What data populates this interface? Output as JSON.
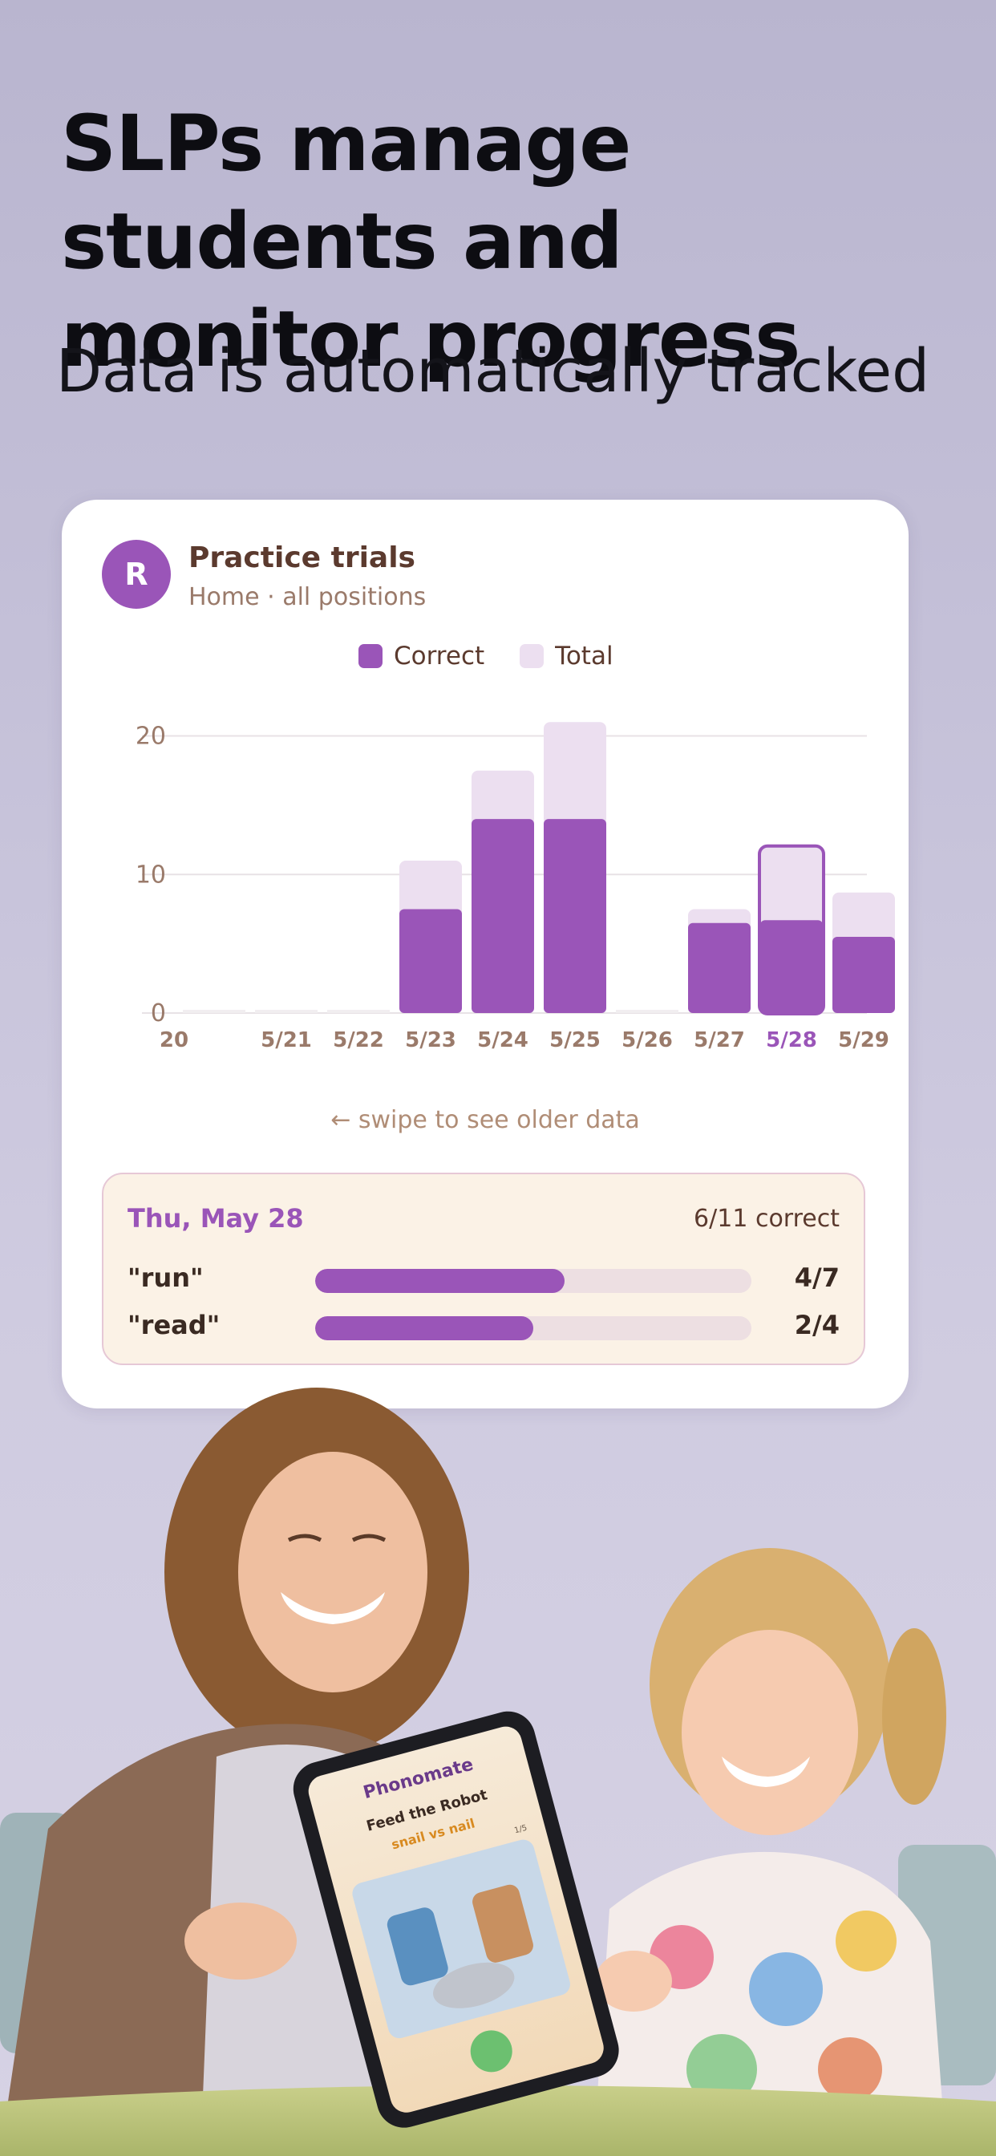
{
  "hero": {
    "title": "SLPs manage students and monitor progress",
    "subtitle": "Data is automatically tracked"
  },
  "card": {
    "avatar_letter": "R",
    "title": "Practice trials",
    "subtitle": "Home · all positions",
    "legend": [
      {
        "label": "Correct",
        "color": "#9a55b8"
      },
      {
        "label": "Total",
        "color": "#ecdff0"
      }
    ],
    "swipe_hint": "← swipe to see older data",
    "detail": {
      "date": "Thu, May 28",
      "summary": "6/11 correct",
      "words": [
        {
          "word": "\"run\"",
          "count": "4/7",
          "fraction": 0.571
        },
        {
          "word": "\"read\"",
          "count": "2/4",
          "fraction": 0.5
        }
      ]
    }
  },
  "chart_data": {
    "type": "bar",
    "categories": [
      "20",
      "5/21",
      "5/22",
      "5/23",
      "5/24",
      "5/25",
      "5/26",
      "5/27",
      "5/28",
      "5/29"
    ],
    "series": [
      {
        "name": "Correct",
        "values": [
          0,
          0,
          0,
          7.5,
          14,
          14,
          0,
          6.5,
          6.7,
          5.5
        ]
      },
      {
        "name": "Total",
        "values": [
          0,
          0,
          0,
          11,
          17.5,
          21,
          0,
          7.5,
          12,
          8.7
        ]
      }
    ],
    "yticks": [
      0,
      10,
      20
    ],
    "ylim": [
      0,
      22
    ],
    "highlighted_category": "5/28",
    "colors": {
      "correct": "#9a55b8",
      "total": "#ecdff0",
      "highlight": "#9a55b8",
      "tick": "#9a7a6a"
    }
  },
  "illustration": {
    "tablet_app_name": "Phonomate",
    "tablet_heading": "Feed the Robot",
    "tablet_words": "snail vs nail",
    "tablet_page": "1/5"
  }
}
